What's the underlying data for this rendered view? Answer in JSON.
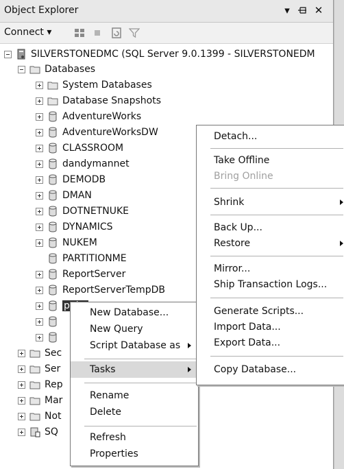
{
  "window": {
    "title": "Object Explorer",
    "pin_label": "▾",
    "dock_label": "ᐩ",
    "close_label": "✕"
  },
  "toolbar": {
    "connect_label": "Connect ▾"
  },
  "tree": {
    "server": "SILVERSTONEDMC (SQL Server 9.0.1399 - SILVERSTONEDM",
    "databases_folder": "Databases",
    "items": [
      "System Databases",
      "Database Snapshots",
      "AdventureWorks",
      "AdventureWorksDW",
      "CLASSROOM",
      "dandymannet",
      "DEMODB",
      "DMAN",
      "DOTNETNUKE",
      "DYNAMICS",
      "NUKEM",
      "PARTITIONME",
      "ReportServer",
      "ReportServerTempDB",
      "pubs"
    ],
    "folders_partial": [
      "Sec",
      "Ser",
      "Rep",
      "Mar",
      "Not",
      "SQ"
    ]
  },
  "context_menu": {
    "items": {
      "new_database": "New Database...",
      "new_query": "New Query",
      "script_database_as": "Script Database as",
      "tasks": "Tasks",
      "rename": "Rename",
      "delete": "Delete",
      "refresh": "Refresh",
      "properties": "Properties"
    }
  },
  "tasks_menu": {
    "items": {
      "detach": "Detach...",
      "take_offline": "Take Offline",
      "bring_online": "Bring Online",
      "shrink": "Shrink",
      "back_up": "Back Up...",
      "restore": "Restore",
      "mirror": "Mirror...",
      "ship_logs": "Ship Transaction Logs...",
      "generate_scripts": "Generate Scripts...",
      "import_data": "Import Data...",
      "export_data": "Export Data...",
      "copy_database": "Copy Database..."
    }
  }
}
